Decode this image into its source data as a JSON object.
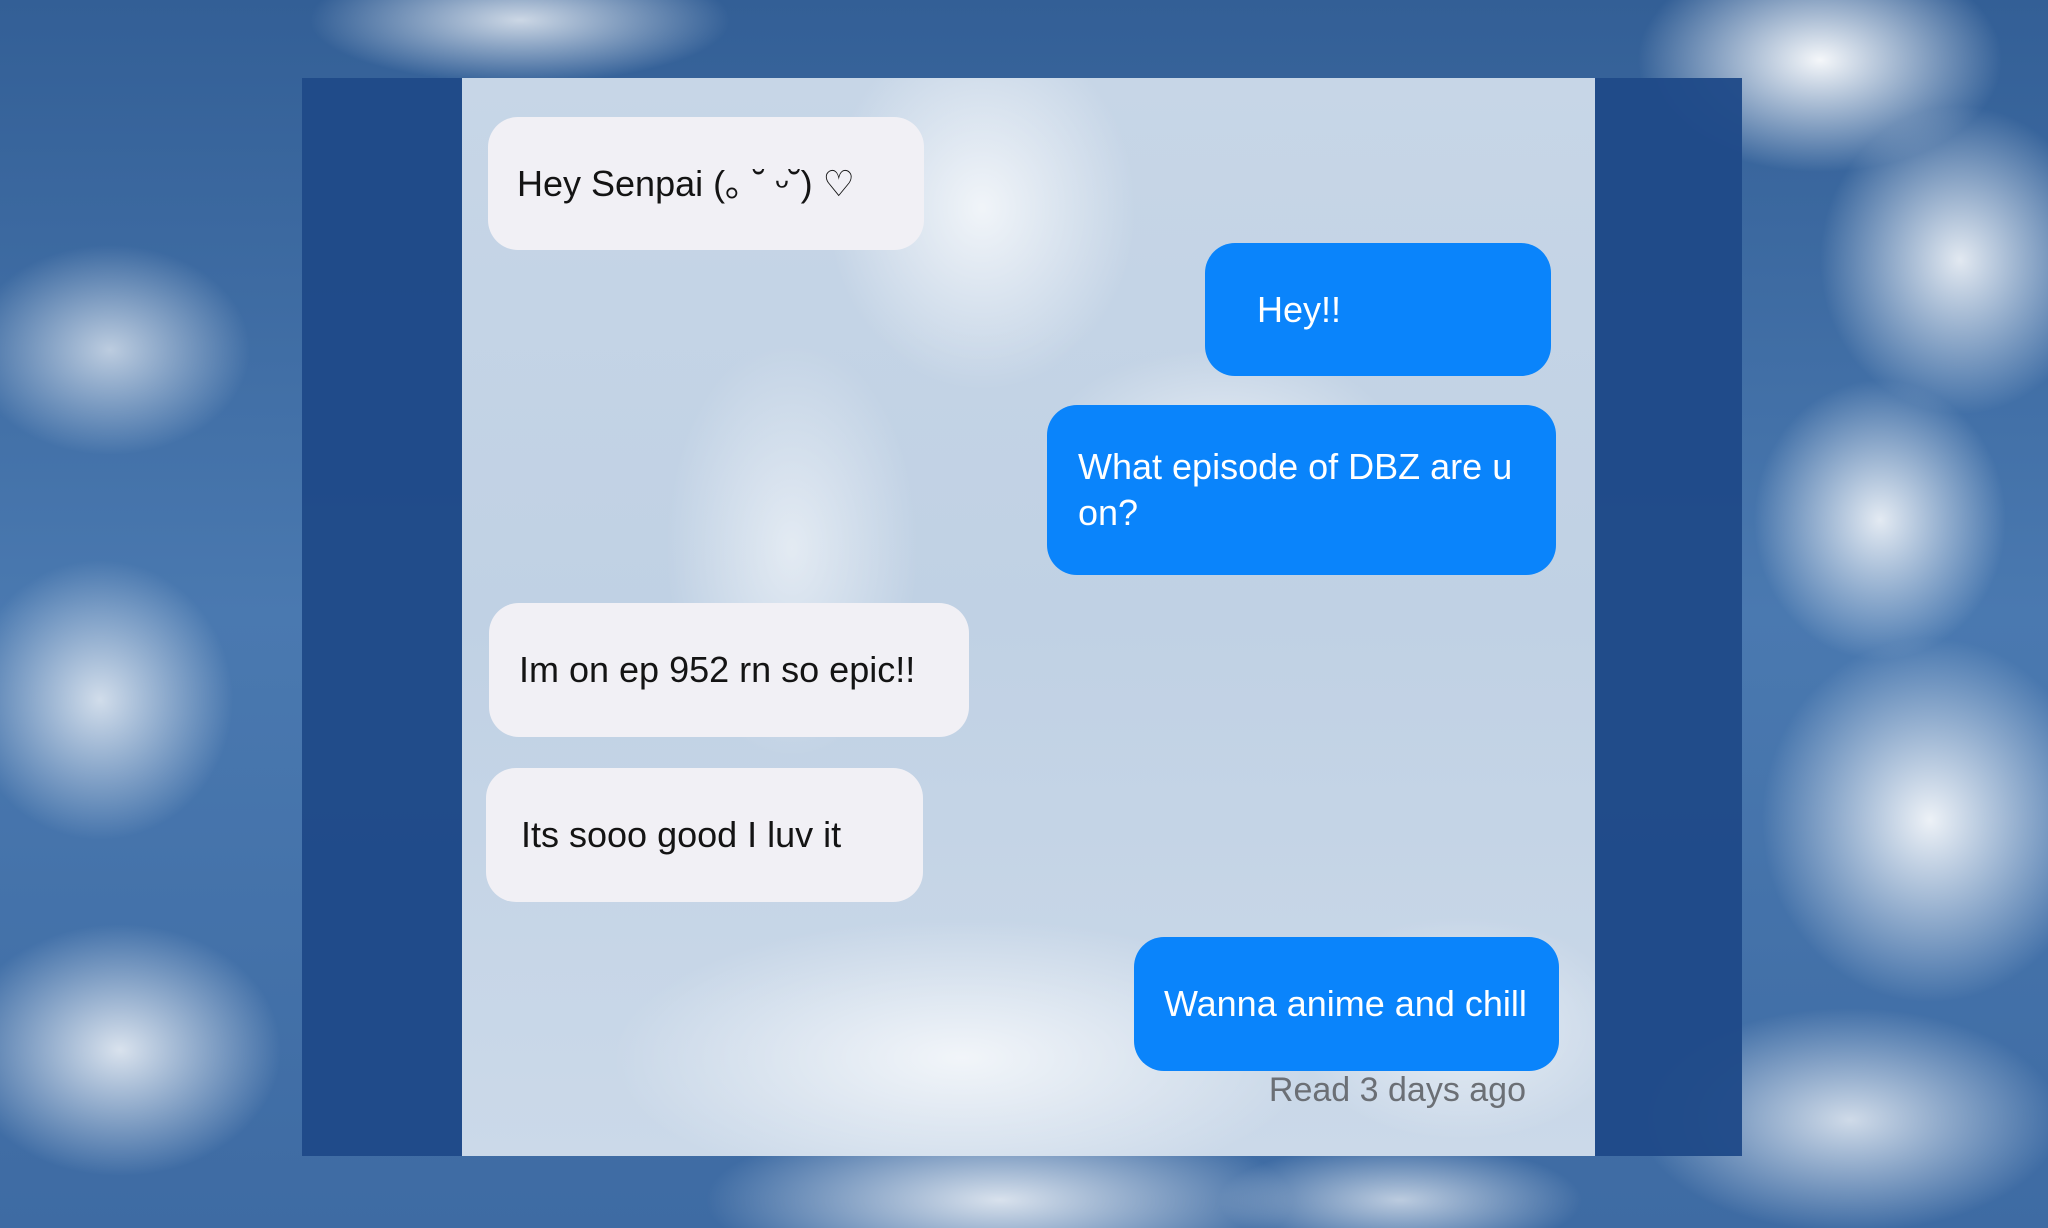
{
  "conversation": {
    "messages": [
      {
        "direction": "incoming",
        "text": "Hey Senpai  (｡ ˘ ᵕ˘) ♡"
      },
      {
        "direction": "outgoing",
        "text": "Hey!!"
      },
      {
        "direction": "outgoing",
        "text": "What episode of DBZ are u on?"
      },
      {
        "direction": "incoming",
        "text": "Im on ep 952 rn so epic!!"
      },
      {
        "direction": "incoming",
        "text": "Its sooo good I luv it"
      },
      {
        "direction": "outgoing",
        "text": "Wanna anime and chill"
      }
    ],
    "read_receipt": "Read 3 days ago"
  },
  "colors": {
    "incoming_bubble": "#f1f0f5",
    "outgoing_bubble": "#0a84fb",
    "frame": "#1f4a88",
    "receipt_text": "#6b6f75"
  }
}
